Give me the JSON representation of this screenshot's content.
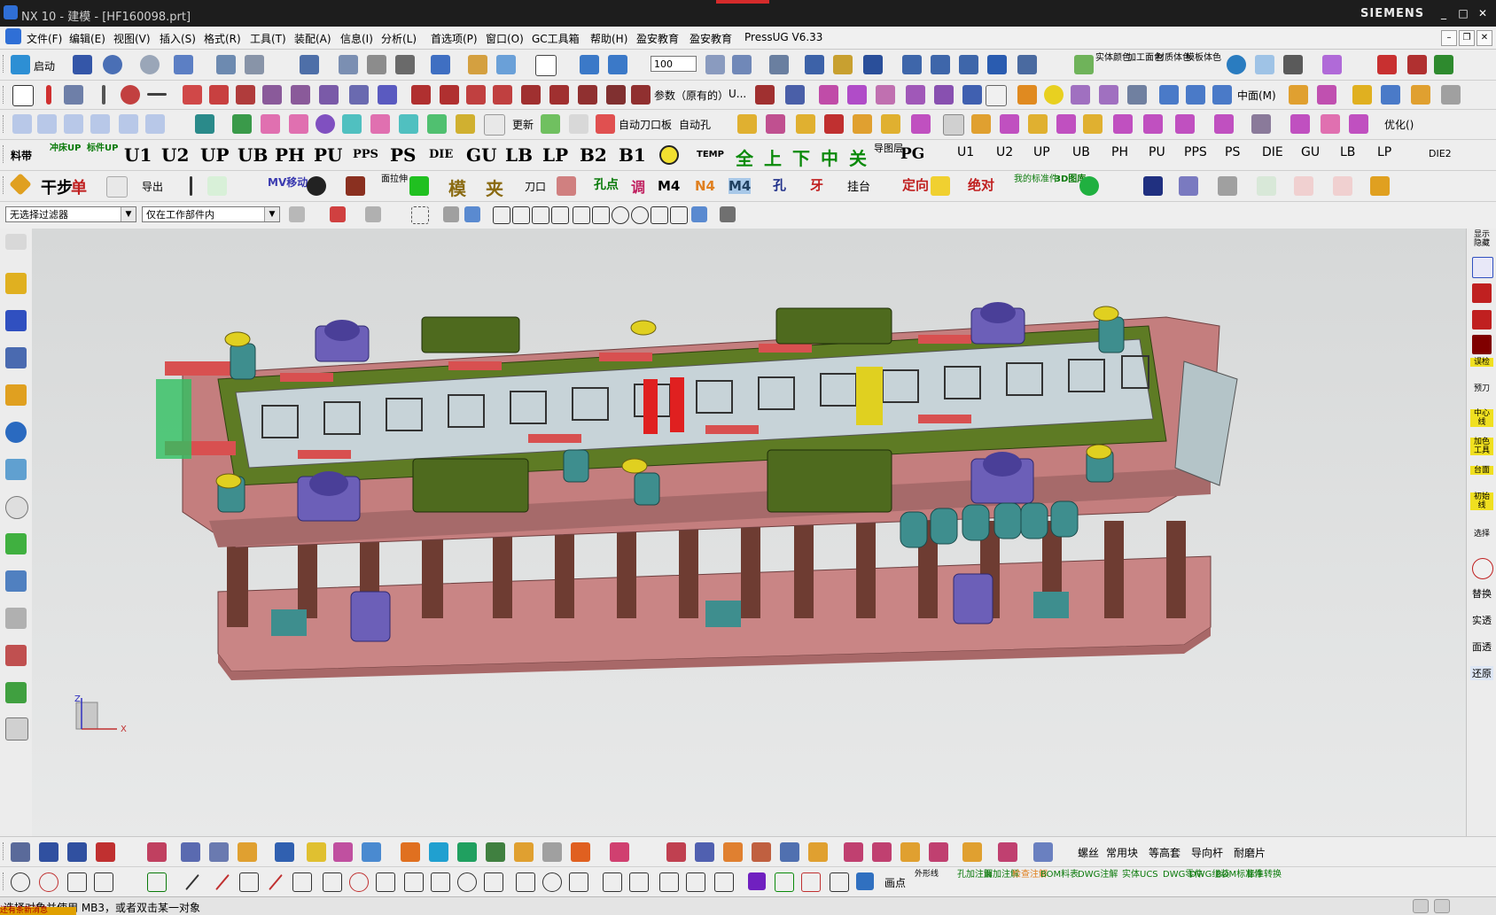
{
  "window": {
    "title": "NX 10 - 建模 - [HF160098.prt]",
    "brand": "SIEMENS"
  },
  "menu": [
    "文件(F)",
    "编辑(E)",
    "视图(V)",
    "插入(S)",
    "格式(R)",
    "工具(T)",
    "装配(A)",
    "信息(I)",
    "分析(L)",
    "首选项(P)",
    "窗口(O)",
    "GC工具箱",
    "帮助(H)",
    "盈安教育",
    "盈安教育",
    "PressUG V6.33"
  ],
  "toolbar1": {
    "start_label": "启动",
    "zoom_value": "100",
    "labels": [
      "实体颜色",
      "加工面色",
      "材质体色",
      "模板体色"
    ]
  },
  "toolbar2": {
    "labels": [
      "参数（原有的）",
      "U...",
      "中面(M)"
    ]
  },
  "toolbar3": {
    "labels": [
      "自动刀口板",
      "自动孔",
      "更新",
      "优化()"
    ]
  },
  "toolbar4": {
    "labels": [
      "料带",
      "冲床UP",
      "标件UP",
      "U1",
      "U2",
      "UP",
      "UB",
      "PH",
      "PU",
      "PPS",
      "PS",
      "DIE",
      "GU",
      "LB",
      "LP",
      "B2",
      "B1",
      "TEMP",
      "全",
      "上",
      "下",
      "中",
      "关",
      "导图层",
      "PG",
      "U1",
      "U2",
      "UP",
      "UB",
      "PH",
      "PU",
      "PPS",
      "PS",
      "DIE",
      "GU",
      "LB",
      "LP",
      "DIE2"
    ]
  },
  "toolbar5": {
    "labels": [
      "干步",
      "单",
      "导出",
      "MV移动",
      "面拉伸",
      "模",
      "夹",
      "刀口",
      "孔点",
      "调",
      "M4",
      "N4",
      "M4",
      "孔",
      "牙",
      "挂台",
      "定向",
      "绝对",
      "我的标准件",
      "3D图库"
    ]
  },
  "selection": {
    "filter": "无选择过滤器",
    "scope": "仅在工作部件内"
  },
  "viewport": {
    "axis_x": "X",
    "axis_z": "Z"
  },
  "right_bar": [
    "显示隐藏",
    "误检",
    "预刀",
    "中心线",
    "加色工具",
    "台面",
    "初始线",
    "选择",
    "替换",
    "实透",
    "面透",
    "还原"
  ],
  "bottom1": {
    "labels": [
      "螺丝",
      "常用块",
      "等高套",
      "导向杆",
      "耐磨片"
    ]
  },
  "bottom2": {
    "labels": [
      "画点",
      "外形线",
      "孔加注解",
      "面加注解",
      "检查注解",
      "BOM料表",
      "DWG注解",
      "实体UCS",
      "DWG零件",
      "DWG组装",
      "BOM标准件",
      "标准转换"
    ]
  },
  "status": {
    "message": "选择对象并使用 MB3，或者双击某一对象",
    "cue": "还有条新消息"
  },
  "colors": {
    "model_plate": "#c98585",
    "model_green": "#5e7b24",
    "model_purple": "#6c5fb8",
    "model_teal": "#3e8e8e",
    "model_yellow": "#e0d020"
  }
}
